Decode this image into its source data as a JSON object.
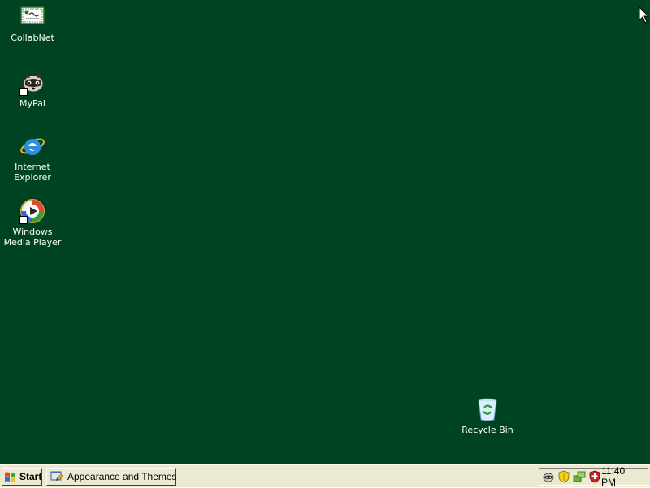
{
  "desktop": {
    "background": "#004322",
    "icons": [
      {
        "label": "CollabNet",
        "icon": "collabnet-certificate-icon"
      },
      {
        "label": "MyPal",
        "icon": "mypal-raccoon-icon"
      },
      {
        "label": "Internet Explorer",
        "icon": "internet-explorer-icon"
      },
      {
        "label": "Windows Media Player",
        "icon": "windows-media-player-icon"
      },
      {
        "label": "Recycle Bin",
        "icon": "recycle-bin-icon"
      }
    ]
  },
  "taskbar": {
    "start_label": "Start",
    "tasks": [
      {
        "label": "Appearance and Themes",
        "icon": "control-panel-icon"
      }
    ],
    "tray": {
      "icons": [
        "mypal-tray-icon",
        "security-shield-icon",
        "network-tray-icon",
        "antivirus-shield-icon"
      ],
      "clock": "11:40 PM"
    }
  }
}
